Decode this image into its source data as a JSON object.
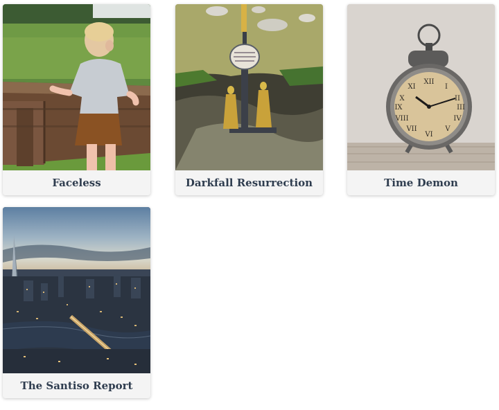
{
  "cards": [
    {
      "title": "Faceless",
      "image": "toddler-at-wooden-planter-photo"
    },
    {
      "title": "Darkfall Resurrection",
      "image": "golden-statue-cross-on-rock-photo"
    },
    {
      "title": "Time Demon",
      "image": "vintage-alarm-clock-photo"
    },
    {
      "title": "The Santiso Report",
      "image": "city-skyline-at-dusk-photo"
    }
  ]
}
